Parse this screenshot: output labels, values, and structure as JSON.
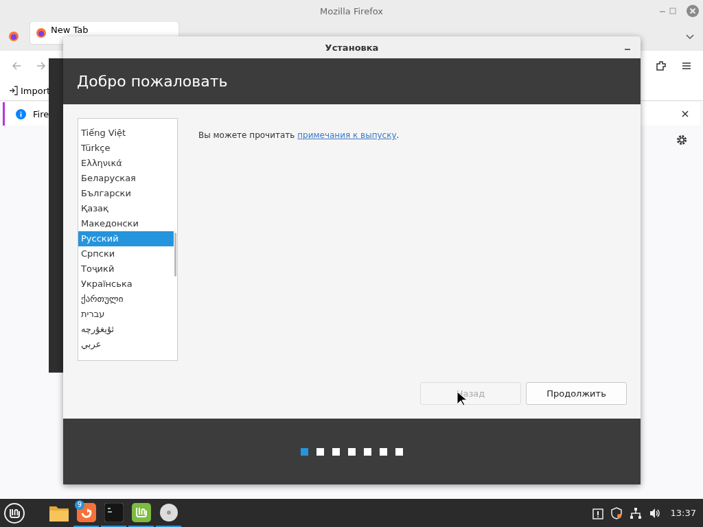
{
  "browser": {
    "title": "Mozilla Firefox",
    "tab": "New Tab",
    "bookmark": "Import",
    "notification": "Fire"
  },
  "installer": {
    "title": "Установка",
    "heading": "Добро пожаловать",
    "languages": [
      {
        "name": "Tiếng Việt",
        "selected": false
      },
      {
        "name": "Türkçe",
        "selected": false
      },
      {
        "name": "Ελληνικά",
        "selected": false
      },
      {
        "name": "Беларуская",
        "selected": false
      },
      {
        "name": "Български",
        "selected": false
      },
      {
        "name": "Қазақ",
        "selected": false
      },
      {
        "name": "Македонски",
        "selected": false
      },
      {
        "name": "Русский",
        "selected": true
      },
      {
        "name": "Српски",
        "selected": false
      },
      {
        "name": "Тоҷикӣ",
        "selected": false
      },
      {
        "name": "Українська",
        "selected": false
      },
      {
        "name": "ქართული",
        "selected": false
      },
      {
        "name": "עברית",
        "selected": false
      },
      {
        "name": "ئۇيغۇرچە",
        "selected": false
      },
      {
        "name": "عربي",
        "selected": false
      }
    ],
    "notes_text": "Вы можете прочитать ",
    "notes_link": "примечания к выпуску",
    "notes_end": ".",
    "buttons": [
      {
        "label": "Назад",
        "disabled": true
      },
      {
        "label": "Продолжить",
        "disabled": false
      }
    ],
    "steps": [
      {
        "selected": true
      },
      {
        "selected": false
      },
      {
        "selected": false
      },
      {
        "selected": false
      },
      {
        "selected": false
      },
      {
        "selected": false
      },
      {
        "selected": false
      }
    ]
  },
  "taskbar": {
    "apps": [
      {
        "kind": "folder",
        "active": false
      },
      {
        "kind": "firefox",
        "active": true,
        "badge": "9"
      },
      {
        "kind": "terminal",
        "active": true
      },
      {
        "kind": "mint",
        "active": true
      },
      {
        "kind": "disc",
        "active": true
      }
    ],
    "clock": "13:37"
  }
}
